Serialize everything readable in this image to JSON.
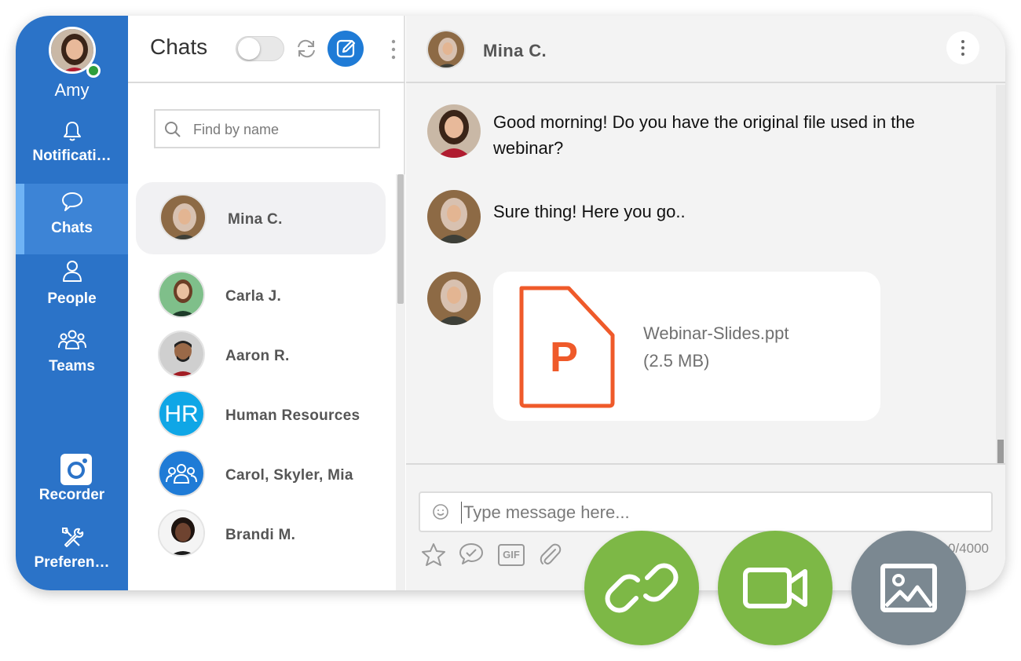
{
  "user": {
    "name": "Amy",
    "status": "online"
  },
  "nav": {
    "items": [
      {
        "label": "Notificati…",
        "icon": "bell-icon"
      },
      {
        "label": "Chats",
        "icon": "speech-bubble-icon",
        "active": true
      },
      {
        "label": "People",
        "icon": "person-icon"
      },
      {
        "label": "Teams",
        "icon": "group-icon"
      },
      {
        "label": "Recorder",
        "icon": "camera-icon"
      },
      {
        "label": "Preferen…",
        "icon": "tools-icon"
      }
    ]
  },
  "list": {
    "title": "Chats",
    "search_placeholder": "Find by name",
    "contacts": [
      {
        "name": "Mina C.",
        "selected": true
      },
      {
        "name": "Carla J."
      },
      {
        "name": "Aaron R."
      },
      {
        "name": "Human Resources",
        "initials": "HR"
      },
      {
        "name": "Carol, Skyler, Mia"
      },
      {
        "name": "Brandi M."
      }
    ]
  },
  "conversation": {
    "contact_name": "Mina C.",
    "messages": [
      {
        "from": "Amy",
        "text": "Good morning! Do you have the original file used in the webinar?"
      },
      {
        "from": "Mina C.",
        "text": "Sure thing! Here you go.."
      },
      {
        "from": "Mina C.",
        "file": {
          "icon_letter": "P",
          "name": "Webinar-Slides.ppt",
          "size": "(2.5 MB)"
        }
      }
    ],
    "input_placeholder": "Type message here...",
    "char_count": "0/4000",
    "gif_label": "GIF"
  },
  "actions": [
    {
      "name": "link",
      "icon": "link-icon",
      "color": "#7db846"
    },
    {
      "name": "video",
      "icon": "video-camera-icon",
      "color": "#7db846"
    },
    {
      "name": "image",
      "icon": "image-icon",
      "color": "#7b8891"
    }
  ],
  "colors": {
    "rail": "#2b73c8",
    "accent": "#1f7bd6",
    "file_orange": "#ef5a2a",
    "online": "#2e9e3b"
  }
}
